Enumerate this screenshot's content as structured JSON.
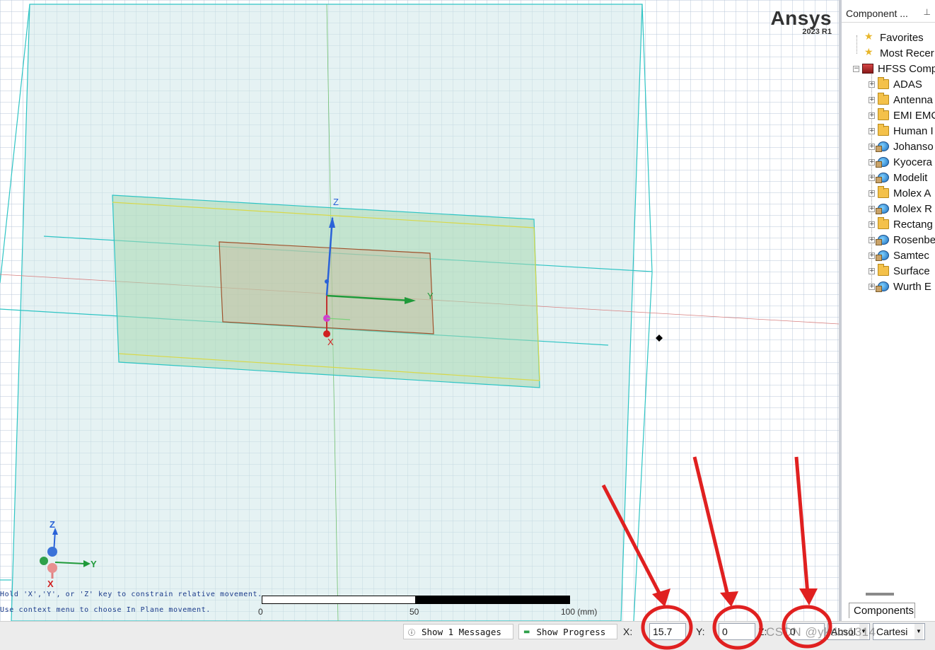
{
  "viewport": {
    "logo": {
      "brand": "Ansys",
      "version": "2023 R1"
    },
    "axes": {
      "z": "Z",
      "y": "Y",
      "x": "X"
    },
    "hints": [
      "Hold 'X','Y', or 'Z' key to constrain relative movement.",
      "Use context menu to choose In Plane movement."
    ],
    "ruler": {
      "labels": [
        "0",
        "50",
        "100 (mm)"
      ]
    }
  },
  "component_panel": {
    "title": "Component ...",
    "pin_icon": "pin-icon",
    "tab_label": "Components",
    "items": [
      {
        "label": "Favorites",
        "icon": "favorites-icon",
        "level": 1
      },
      {
        "label": "Most Recer",
        "icon": "favorites-icon",
        "level": 1
      },
      {
        "label": "HFSS Comp",
        "icon": "hfss-library-icon",
        "level": 0,
        "expander": "⊟"
      },
      {
        "label": "ADAS",
        "icon": "folder-icon",
        "level": 1,
        "expander": "+"
      },
      {
        "label": "Antenna",
        "icon": "folder-icon",
        "level": 1,
        "expander": "+"
      },
      {
        "label": "EMI EMC",
        "icon": "folder-icon",
        "level": 1,
        "expander": "+"
      },
      {
        "label": "Human I",
        "icon": "folder-icon",
        "level": 1,
        "expander": "+"
      },
      {
        "label": "Johanso",
        "icon": "web-library-icon",
        "level": 1,
        "expander": "+"
      },
      {
        "label": "Kyocera",
        "icon": "web-library-icon",
        "level": 1,
        "expander": "+"
      },
      {
        "label": "Modelit",
        "icon": "web-library-icon",
        "level": 1,
        "expander": "+"
      },
      {
        "label": "Molex A",
        "icon": "folder-icon",
        "level": 1,
        "expander": "+"
      },
      {
        "label": "Molex R",
        "icon": "web-library-icon",
        "level": 1,
        "expander": "+"
      },
      {
        "label": "Rectang",
        "icon": "folder-icon",
        "level": 1,
        "expander": "+"
      },
      {
        "label": "Rosenbe",
        "icon": "web-library-icon",
        "level": 1,
        "expander": "+"
      },
      {
        "label": "Samtec",
        "icon": "web-library-icon",
        "level": 1,
        "expander": "+"
      },
      {
        "label": "Surface",
        "icon": "folder-icon",
        "level": 1,
        "expander": "+"
      },
      {
        "label": "Wurth E",
        "icon": "web-library-icon",
        "level": 1,
        "expander": "+"
      }
    ]
  },
  "statusbar": {
    "messages_button": "Show 1 Messages",
    "progress_button": "Show Progress",
    "x_label": "X:",
    "x_value": "15.7",
    "y_label": "Y:",
    "y_value": "0",
    "z_label": "Z:",
    "z_value": "0",
    "mode_select": "Absol",
    "coord_select": "Cartesi",
    "watermark": "CSDN @ykdm1314"
  },
  "colors": {
    "region_fill": "#cfe8ea",
    "region_edge": "#2ec4c4",
    "substrate_fill": "#a8d8b0",
    "patch_edge": "#a0522d",
    "annotation_red": "#e02020"
  }
}
